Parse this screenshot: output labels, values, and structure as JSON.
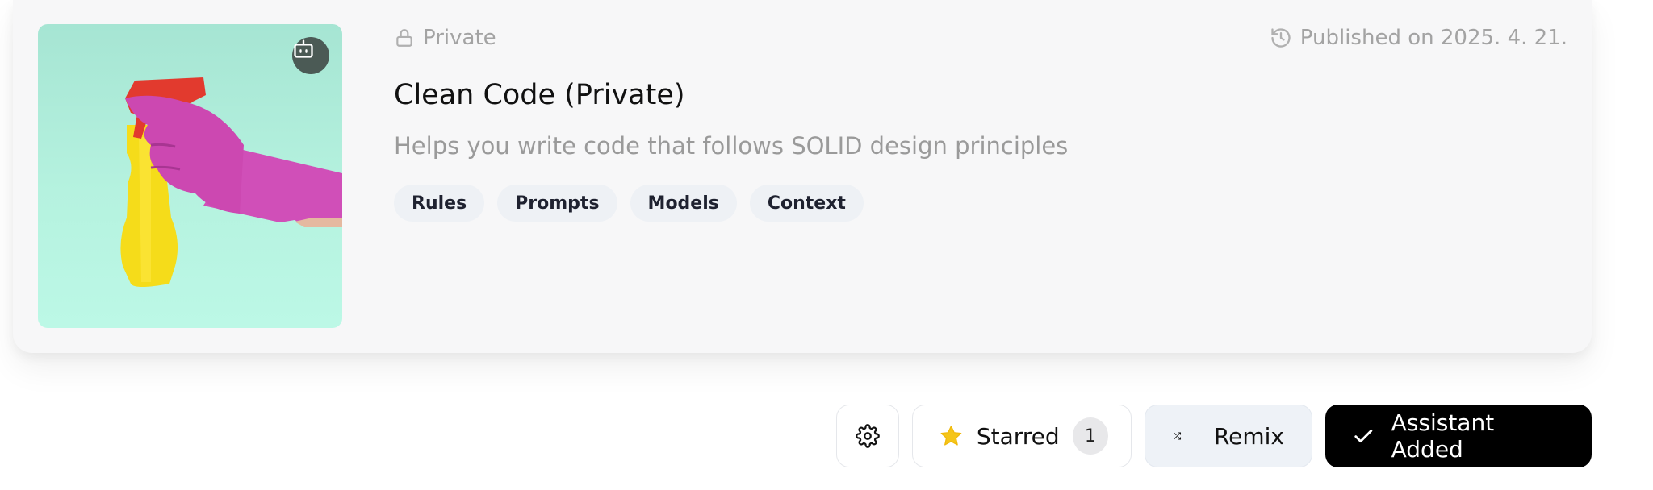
{
  "card": {
    "visibility_label": "Private",
    "published_label": "Published on 2025. 4. 21.",
    "title": "Clean Code (Private)",
    "description": "Helps you write code that follows SOLID design principles",
    "tags": [
      "Rules",
      "Prompts",
      "Models",
      "Context"
    ],
    "image": {
      "subject": "gloved hand holding a yellow spray bottle",
      "badge_icon": "robot-icon"
    }
  },
  "actions": {
    "settings_icon": "gear-icon",
    "starred_label": "Starred",
    "starred_count": "1",
    "remix_label": "Remix",
    "added_label": "Assistant Added"
  },
  "colors": {
    "accent_star": "#f5c518",
    "primary_button": "#000000",
    "tag_background": "#eef1f5"
  }
}
